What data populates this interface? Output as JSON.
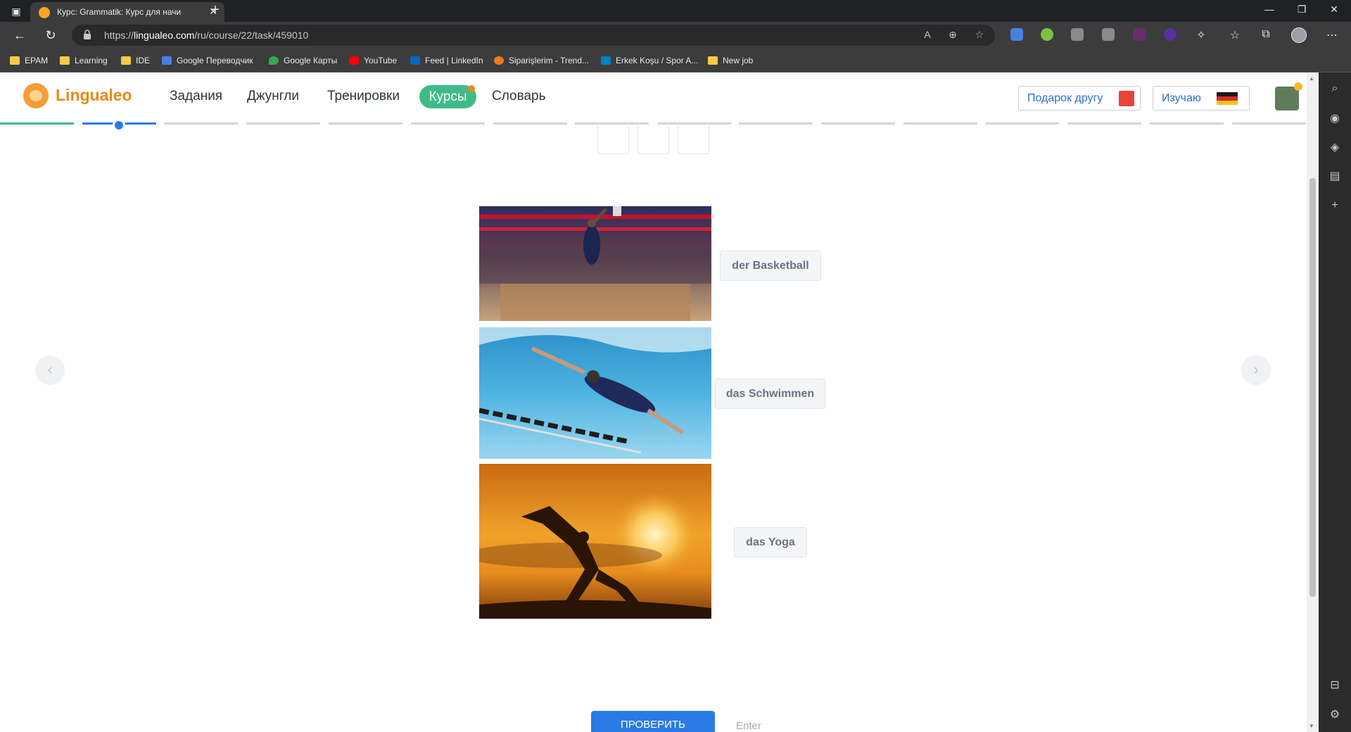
{
  "browser": {
    "tab_title": "Курс: Grammatik: Курс для начи",
    "url_prefix": "https://",
    "url_domain": "lingualeo.com",
    "url_path": "/ru/course/22/task/459010",
    "bookmarks": [
      {
        "label": "EPAM",
        "icon": "folder-icon"
      },
      {
        "label": "Learning",
        "icon": "folder-icon"
      },
      {
        "label": "IDE",
        "icon": "folder-icon"
      },
      {
        "label": "Google Переводчик",
        "icon": "translate-icon"
      },
      {
        "label": "Google Карты",
        "icon": "maps-icon"
      },
      {
        "label": "YouTube",
        "icon": "youtube-icon"
      },
      {
        "label": "Feed | LinkedIn",
        "icon": "linkedin-icon"
      },
      {
        "label": "Siparişlerim - Trend...",
        "icon": "trendyol-icon"
      },
      {
        "label": "Erkek Koşu / Spor A...",
        "icon": "decathlon-icon"
      },
      {
        "label": "New job",
        "icon": "folder-icon"
      }
    ]
  },
  "site": {
    "logo_text": "Lingualeo",
    "nav": [
      "Задания",
      "Джунгли",
      "Тренировки",
      "Курсы",
      "Словарь"
    ],
    "active_nav": "Курсы",
    "gift_button": "Подарок другу",
    "learning_button": "Изучаю",
    "learning_flag": "germany-flag-icon"
  },
  "exercise": {
    "items": [
      {
        "image": "basketball-photo",
        "word": "der Basketball"
      },
      {
        "image": "swimming-photo",
        "word": "das Schwimmen"
      },
      {
        "image": "yoga-photo",
        "word": "das Yoga"
      }
    ],
    "check_button": "ПРОВЕРИТЬ",
    "enter_hint": "Enter"
  },
  "colors": {
    "brand_orange": "#e88a1a",
    "active_green": "#3ebc87",
    "primary_blue": "#2b7be4"
  }
}
